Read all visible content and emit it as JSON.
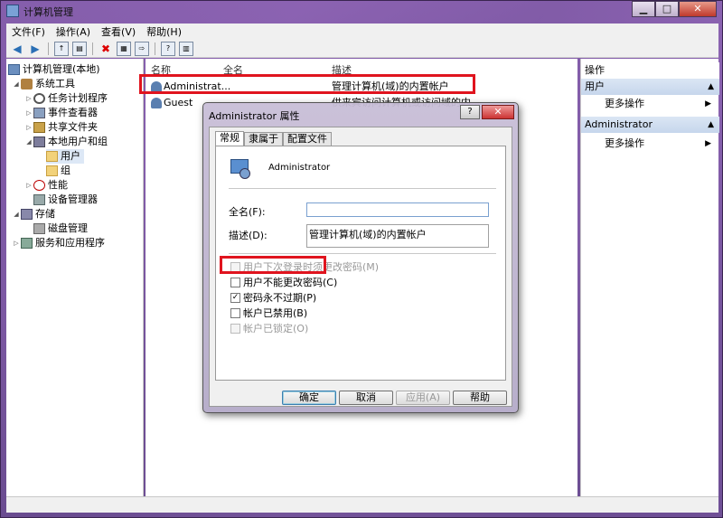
{
  "window": {
    "title": "计算机管理",
    "min_label": "▁",
    "max_label": "□",
    "close_label": "✕"
  },
  "menu": [
    "文件(F)",
    "操作(A)",
    "查看(V)",
    "帮助(H)"
  ],
  "tree": {
    "root": "计算机管理(本地)",
    "system_tools": "系统工具",
    "task_scheduler": "任务计划程序",
    "event_viewer": "事件查看器",
    "shared_folders": "共享文件夹",
    "local_users_groups": "本地用户和组",
    "users": "用户",
    "groups": "组",
    "performance": "性能",
    "device_manager": "设备管理器",
    "storage": "存储",
    "disk_management": "磁盘管理",
    "services_apps": "服务和应用程序"
  },
  "list": {
    "headers": [
      "名称",
      "全名",
      "描述"
    ],
    "rows": [
      {
        "name": "Administrat...",
        "fullname": "",
        "desc": "管理计算机(域)的内置帐户"
      },
      {
        "name": "Guest",
        "fullname": "",
        "desc": "供来宾访问计算机或访问域的内..."
      }
    ]
  },
  "actions": {
    "header": "操作",
    "section1": "用户",
    "more1": "更多操作",
    "section2": "Administrator",
    "more2": "更多操作"
  },
  "dialog": {
    "title": "Administrator 属性",
    "help_label": "?",
    "close_label": "✕",
    "tabs": [
      "常规",
      "隶属于",
      "配置文件"
    ],
    "username": "Administrator",
    "fullname_label": "全名(F):",
    "fullname_value": "",
    "desc_label": "描述(D):",
    "desc_value": "管理计算机(域)的内置帐户",
    "checkboxes": [
      {
        "label": "用户下次登录时须更改密码(M)",
        "checked": false,
        "disabled": true
      },
      {
        "label": "用户不能更改密码(C)",
        "checked": false,
        "disabled": false
      },
      {
        "label": "密码永不过期(P)",
        "checked": true,
        "disabled": false
      },
      {
        "label": "帐户已禁用(B)",
        "checked": false,
        "disabled": false
      },
      {
        "label": "帐户已锁定(O)",
        "checked": false,
        "disabled": true
      }
    ],
    "buttons": {
      "ok": "确定",
      "cancel": "取消",
      "apply": "应用(A)",
      "help": "帮助"
    }
  },
  "colors": {
    "highlight": "#e0141e",
    "accent": "#3c7fb1"
  }
}
